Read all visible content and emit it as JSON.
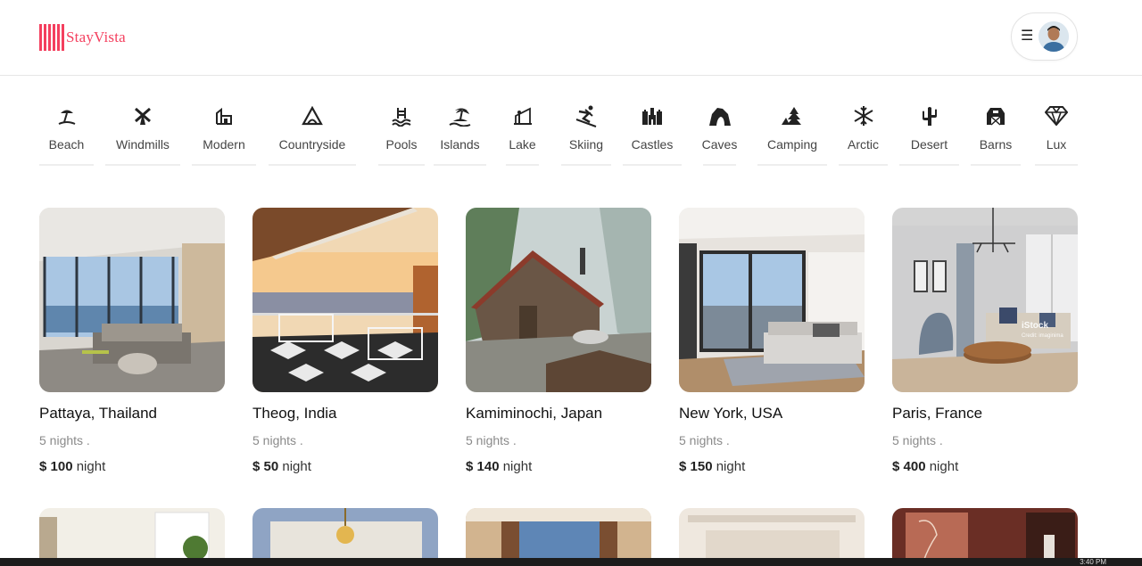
{
  "brand": {
    "name": "StayVista",
    "color": "#f43f5e"
  },
  "header": {
    "menu_icon": "hamburger-icon",
    "avatar": "user-avatar"
  },
  "categories": [
    {
      "label": "Beach",
      "icon": "beach-icon"
    },
    {
      "label": "Windmills",
      "icon": "windmill-icon"
    },
    {
      "label": "Modern",
      "icon": "modern-house-icon"
    },
    {
      "label": "Countryside",
      "icon": "countryside-icon"
    },
    {
      "label": "Pools",
      "icon": "pool-icon"
    },
    {
      "label": "Islands",
      "icon": "island-icon"
    },
    {
      "label": "Lake",
      "icon": "lake-icon"
    },
    {
      "label": "Skiing",
      "icon": "skiing-icon"
    },
    {
      "label": "Castles",
      "icon": "castle-icon"
    },
    {
      "label": "Caves",
      "icon": "cave-icon"
    },
    {
      "label": "Camping",
      "icon": "camping-icon"
    },
    {
      "label": "Arctic",
      "icon": "snowflake-icon"
    },
    {
      "label": "Desert",
      "icon": "cactus-icon"
    },
    {
      "label": "Barns",
      "icon": "barn-icon"
    },
    {
      "label": "Lux",
      "icon": "diamond-icon"
    }
  ],
  "listings": [
    {
      "location": "Pattaya, Thailand",
      "nights": "5 nights .",
      "price": "$ 100",
      "unit": "night"
    },
    {
      "location": "Theog, India",
      "nights": "5 nights .",
      "price": "$ 50",
      "unit": "night"
    },
    {
      "location": "Kamiminochi, Japan",
      "nights": "5 nights .",
      "price": "$ 140",
      "unit": "night"
    },
    {
      "location": "New York, USA",
      "nights": "5 nights .",
      "price": "$ 150",
      "unit": "night"
    },
    {
      "location": "Paris, France",
      "nights": "5 nights .",
      "price": "$ 400",
      "unit": "night"
    }
  ],
  "watermark": {
    "title": "iStock",
    "credit": "Credit: imaginima"
  },
  "taskbar": {
    "clock": "3:40 PM"
  }
}
